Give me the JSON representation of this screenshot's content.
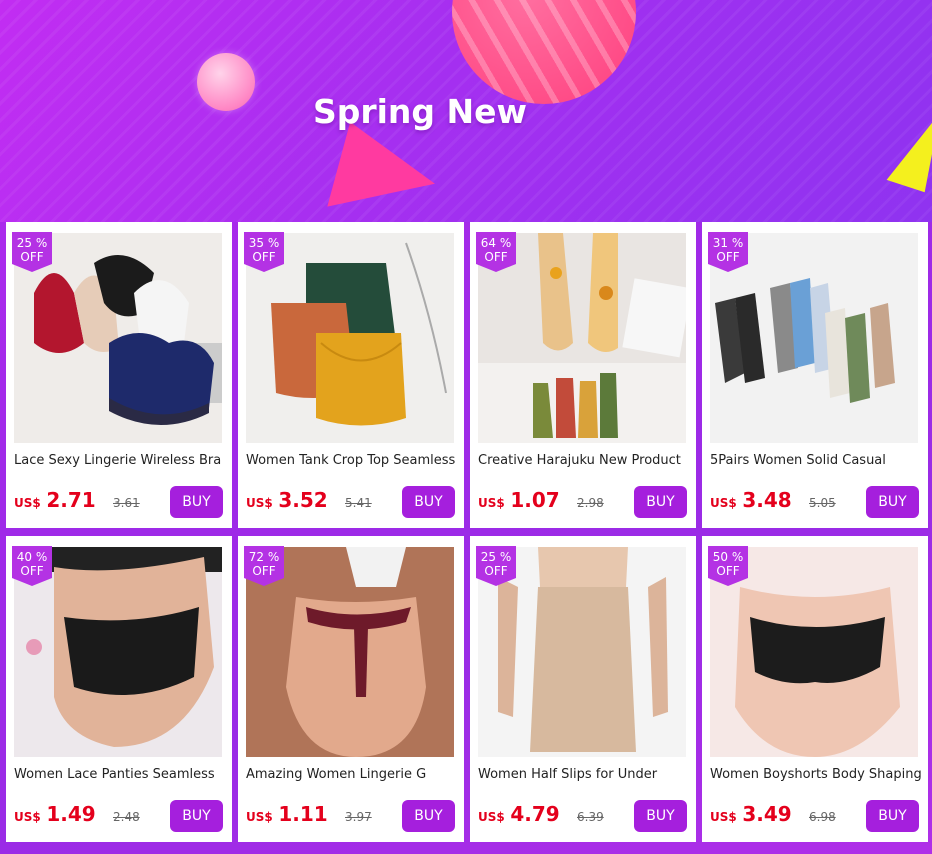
{
  "banner": {
    "title": "Spring New"
  },
  "products": [
    {
      "discount_pct": "25 %",
      "discount_label": "OFF",
      "name": "Lace Sexy Lingerie Wireless Bra",
      "currency": "US$",
      "price": "2.71",
      "original_price": "3.61",
      "buy_label": "BUY"
    },
    {
      "discount_pct": "35 %",
      "discount_label": "OFF",
      "name": "Women Tank Crop Top Seamless",
      "currency": "US$",
      "price": "3.52",
      "original_price": "5.41",
      "buy_label": "BUY"
    },
    {
      "discount_pct": "64 %",
      "discount_label": "OFF",
      "name": "Creative Harajuku New Product",
      "currency": "US$",
      "price": "1.07",
      "original_price": "2.98",
      "buy_label": "BUY"
    },
    {
      "discount_pct": "31 %",
      "discount_label": "OFF",
      "name": "5Pairs Women Solid Casual",
      "currency": "US$",
      "price": "3.48",
      "original_price": "5.05",
      "buy_label": "BUY"
    },
    {
      "discount_pct": "40 %",
      "discount_label": "OFF",
      "name": "Women Lace Panties Seamless",
      "currency": "US$",
      "price": "1.49",
      "original_price": "2.48",
      "buy_label": "BUY"
    },
    {
      "discount_pct": "72 %",
      "discount_label": "OFF",
      "name": "Amazing Women Lingerie G",
      "currency": "US$",
      "price": "1.11",
      "original_price": "3.97",
      "buy_label": "BUY"
    },
    {
      "discount_pct": "25 %",
      "discount_label": "OFF",
      "name": "Women Half Slips for Under",
      "currency": "US$",
      "price": "4.79",
      "original_price": "6.39",
      "buy_label": "BUY"
    },
    {
      "discount_pct": "50 %",
      "discount_label": "OFF",
      "name": "Women Boyshorts Body Shaping",
      "currency": "US$",
      "price": "3.49",
      "original_price": "6.98",
      "buy_label": "BUY"
    }
  ],
  "colors": {
    "accent": "#a51fdd",
    "price": "#e4001c",
    "badge": "#b432e4"
  }
}
